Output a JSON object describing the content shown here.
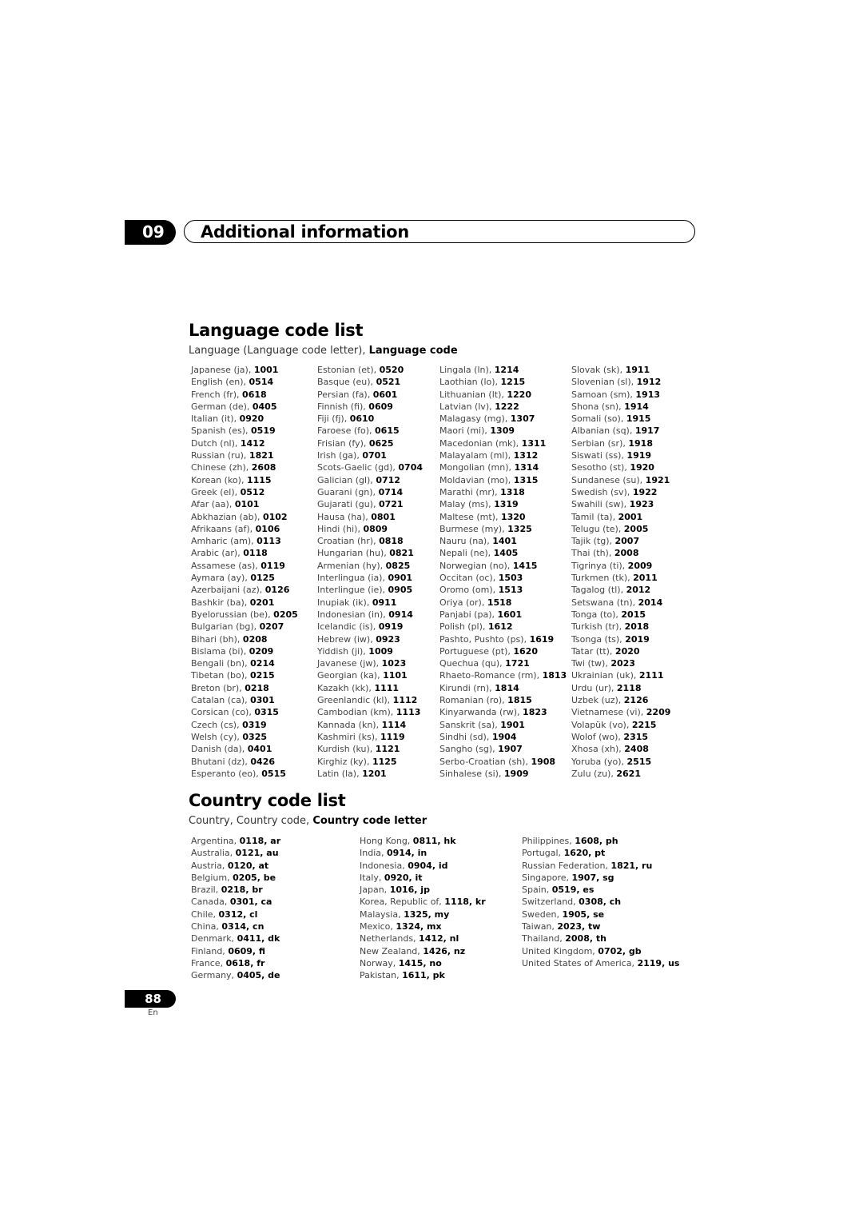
{
  "chapter": {
    "number": "09",
    "title": "Additional information"
  },
  "language_section": {
    "title": "Language code list",
    "subtitle_plain": "Language (Language code letter), ",
    "subtitle_bold": "Language code",
    "columns": [
      [
        [
          "Japanese (ja), ",
          "1001"
        ],
        [
          "English (en), ",
          "0514"
        ],
        [
          "French (fr), ",
          "0618"
        ],
        [
          "German (de), ",
          "0405"
        ],
        [
          "Italian (it), ",
          "0920"
        ],
        [
          "Spanish (es), ",
          "0519"
        ],
        [
          "Dutch (nl), ",
          "1412"
        ],
        [
          "Russian (ru), ",
          "1821"
        ],
        [
          "Chinese (zh), ",
          "2608"
        ],
        [
          "Korean (ko), ",
          "1115"
        ],
        [
          "Greek (el), ",
          "0512"
        ],
        [
          "Afar (aa), ",
          "0101"
        ],
        [
          "Abkhazian (ab), ",
          "0102"
        ],
        [
          "Afrikaans (af), ",
          "0106"
        ],
        [
          "Amharic (am), ",
          "0113"
        ],
        [
          "Arabic (ar), ",
          "0118"
        ],
        [
          "Assamese (as), ",
          "0119"
        ],
        [
          "Aymara (ay), ",
          "0125"
        ],
        [
          "Azerbaijani (az), ",
          "0126"
        ],
        [
          "Bashkir (ba), ",
          "0201"
        ],
        [
          "Byelorussian (be), ",
          "0205"
        ],
        [
          "Bulgarian (bg), ",
          "0207"
        ],
        [
          "Bihari (bh), ",
          "0208"
        ],
        [
          "Bislama (bi), ",
          "0209"
        ],
        [
          "Bengali (bn), ",
          "0214"
        ],
        [
          "Tibetan (bo), ",
          "0215"
        ],
        [
          "Breton (br), ",
          "0218"
        ],
        [
          "Catalan (ca), ",
          "0301"
        ],
        [
          "Corsican (co), ",
          "0315"
        ],
        [
          "Czech (cs), ",
          "0319"
        ],
        [
          "Welsh (cy), ",
          "0325"
        ],
        [
          "Danish (da), ",
          "0401"
        ],
        [
          "Bhutani (dz), ",
          "0426"
        ],
        [
          "Esperanto (eo), ",
          "0515"
        ]
      ],
      [
        [
          "Estonian (et), ",
          "0520"
        ],
        [
          "Basque (eu), ",
          "0521"
        ],
        [
          "Persian (fa), ",
          "0601"
        ],
        [
          "Finnish (fi), ",
          "0609"
        ],
        [
          "Fiji (fj), ",
          "0610"
        ],
        [
          "Faroese (fo), ",
          "0615"
        ],
        [
          "Frisian (fy), ",
          "0625"
        ],
        [
          "Irish (ga), ",
          "0701"
        ],
        [
          "Scots-Gaelic (gd), ",
          "0704"
        ],
        [
          "Galician (gl), ",
          "0712"
        ],
        [
          "Guarani (gn), ",
          "0714"
        ],
        [
          "Gujarati (gu), ",
          "0721"
        ],
        [
          "Hausa (ha), ",
          "0801"
        ],
        [
          "Hindi (hi), ",
          "0809"
        ],
        [
          "Croatian (hr), ",
          "0818"
        ],
        [
          "Hungarian (hu), ",
          "0821"
        ],
        [
          "Armenian (hy), ",
          "0825"
        ],
        [
          "Interlingua (ia), ",
          "0901"
        ],
        [
          "Interlingue (ie), ",
          "0905"
        ],
        [
          "Inupiak (ik), ",
          "0911"
        ],
        [
          "Indonesian (in), ",
          "0914"
        ],
        [
          "Icelandic (is), ",
          "0919"
        ],
        [
          "Hebrew (iw), ",
          "0923"
        ],
        [
          "Yiddish (ji), ",
          "1009"
        ],
        [
          "Javanese (jw), ",
          "1023"
        ],
        [
          "Georgian (ka), ",
          "1101"
        ],
        [
          "Kazakh (kk), ",
          "1111"
        ],
        [
          "Greenlandic  (kl), ",
          "1112"
        ],
        [
          "Cambodian (km), ",
          "1113"
        ],
        [
          "Kannada (kn), ",
          "1114"
        ],
        [
          "Kashmiri (ks), ",
          "1119"
        ],
        [
          "Kurdish (ku), ",
          "1121"
        ],
        [
          "Kirghiz (ky), ",
          "1125"
        ],
        [
          "Latin (la), ",
          "1201"
        ]
      ],
      [
        [
          "Lingala (ln), ",
          "1214"
        ],
        [
          "Laothian (lo), ",
          "1215"
        ],
        [
          "Lithuanian (lt), ",
          "1220"
        ],
        [
          "Latvian (lv), ",
          "1222"
        ],
        [
          "Malagasy (mg), ",
          "1307"
        ],
        [
          "Maori (mi), ",
          "1309"
        ],
        [
          "Macedonian (mk), ",
          "1311"
        ],
        [
          "Malayalam  (ml), ",
          "1312"
        ],
        [
          "Mongolian (mn), ",
          "1314"
        ],
        [
          "Moldavian (mo), ",
          "1315"
        ],
        [
          "Marathi (mr), ",
          "1318"
        ],
        [
          "Malay  (ms), ",
          "1319"
        ],
        [
          "Maltese (mt), ",
          "1320"
        ],
        [
          "Burmese (my), ",
          "1325"
        ],
        [
          "Nauru (na), ",
          "1401"
        ],
        [
          "Nepali (ne), ",
          "1405"
        ],
        [
          "Norwegian (no), ",
          "1415"
        ],
        [
          "Occitan (oc), ",
          "1503"
        ],
        [
          "Oromo (om), ",
          "1513"
        ],
        [
          "Oriya (or), ",
          "1518"
        ],
        [
          "Panjabi (pa), ",
          "1601"
        ],
        [
          "Polish (pl), ",
          "1612"
        ],
        [
          "Pashto, Pushto (ps), ",
          "1619"
        ],
        [
          "Portuguese (pt), ",
          "1620"
        ],
        [
          "Quechua (qu), ",
          "1721"
        ],
        [
          "Rhaeto-Romance (rm), ",
          "1813"
        ],
        [
          "Kirundi (rn), ",
          "1814"
        ],
        [
          "Romanian (ro), ",
          "1815"
        ],
        [
          "Kinyarwanda (rw), ",
          "1823"
        ],
        [
          "Sanskrit (sa), ",
          "1901"
        ],
        [
          "Sindhi (sd), ",
          "1904"
        ],
        [
          "Sangho (sg), ",
          "1907"
        ],
        [
          "Serbo-Croatian (sh), ",
          "1908"
        ],
        [
          "Sinhalese (si), ",
          "1909"
        ]
      ],
      [
        [
          "Slovak (sk), ",
          "1911"
        ],
        [
          "Slovenian (sl), ",
          "1912"
        ],
        [
          "Samoan (sm), ",
          "1913"
        ],
        [
          "Shona (sn), ",
          "1914"
        ],
        [
          "Somali (so), ",
          "1915"
        ],
        [
          "Albanian (sq), ",
          "1917"
        ],
        [
          "Serbian (sr), ",
          "1918"
        ],
        [
          "Siswati (ss), ",
          "1919"
        ],
        [
          "Sesotho (st), ",
          "1920"
        ],
        [
          "Sundanese (su), ",
          "1921"
        ],
        [
          "Swedish (sv), ",
          "1922"
        ],
        [
          "Swahili (sw), ",
          "1923"
        ],
        [
          "Tamil (ta), ",
          "2001"
        ],
        [
          "Telugu (te), ",
          "2005"
        ],
        [
          "Tajik (tg), ",
          "2007"
        ],
        [
          "Thai (th), ",
          "2008"
        ],
        [
          "Tigrinya (ti), ",
          "2009"
        ],
        [
          "Turkmen (tk), ",
          "2011"
        ],
        [
          "Tagalog (tl), ",
          "2012"
        ],
        [
          "Setswana (tn), ",
          "2014"
        ],
        [
          "Tonga (to), ",
          "2015"
        ],
        [
          "Turkish (tr), ",
          "2018"
        ],
        [
          "Tsonga (ts), ",
          "2019"
        ],
        [
          "Tatar (tt), ",
          "2020"
        ],
        [
          "Twi (tw), ",
          "2023"
        ],
        [
          "Ukrainian (uk), ",
          "2111"
        ],
        [
          "Urdu (ur), ",
          "2118"
        ],
        [
          "Uzbek (uz), ",
          "2126"
        ],
        [
          "Vietnamese (vi), ",
          "2209"
        ],
        [
          "Volapük (vo), ",
          "2215"
        ],
        [
          "Wolof (wo), ",
          "2315"
        ],
        [
          "Xhosa (xh), ",
          "2408"
        ],
        [
          "Yoruba (yo), ",
          "2515"
        ],
        [
          "Zulu (zu), ",
          "2621"
        ]
      ]
    ]
  },
  "country_section": {
    "title": "Country code list",
    "subtitle_plain": "Country, Country code, ",
    "subtitle_bold": "Country code letter",
    "columns": [
      [
        [
          "Argentina, ",
          "0118, ar"
        ],
        [
          "Australia, ",
          "0121, au"
        ],
        [
          "Austria, ",
          "0120, at"
        ],
        [
          "Belgium, ",
          "0205, be"
        ],
        [
          "Brazil, ",
          "0218, br"
        ],
        [
          "Canada, ",
          "0301, ca"
        ],
        [
          "Chile, ",
          "0312, cl"
        ],
        [
          "China, ",
          "0314, cn"
        ],
        [
          "Denmark, ",
          "0411, dk"
        ],
        [
          "Finland, ",
          "0609, fi"
        ],
        [
          "France, ",
          "0618, fr"
        ],
        [
          "Germany, ",
          "0405, de"
        ]
      ],
      [
        [
          "Hong Kong, ",
          "0811, hk"
        ],
        [
          "India, ",
          "0914, in"
        ],
        [
          "Indonesia, ",
          "0904, id"
        ],
        [
          "Italy, ",
          "0920, it"
        ],
        [
          "Japan, ",
          "1016, jp"
        ],
        [
          "Korea, Republic of, ",
          "1118, kr"
        ],
        [
          "Malaysia, ",
          "1325, my"
        ],
        [
          "Mexico, ",
          "1324, mx"
        ],
        [
          "Netherlands, ",
          "1412, nl"
        ],
        [
          "New Zealand, ",
          "1426, nz"
        ],
        [
          "Norway, ",
          "1415, no"
        ],
        [
          "Pakistan, ",
          "1611, pk"
        ]
      ],
      [
        [
          "Philippines, ",
          "1608, ph"
        ],
        [
          "Portugal, ",
          "1620, pt"
        ],
        [
          "Russian Federation, ",
          "1821, ru"
        ],
        [
          "Singapore, ",
          "1907, sg"
        ],
        [
          "Spain, ",
          "0519, es"
        ],
        [
          "Switzerland, ",
          "0308, ch"
        ],
        [
          "Sweden, ",
          "1905, se"
        ],
        [
          "Taiwan, ",
          "2023, tw"
        ],
        [
          "Thailand, ",
          "2008, th"
        ],
        [
          "United Kingdom, ",
          "0702, gb"
        ],
        [
          "United States of America, ",
          "2119, us"
        ]
      ]
    ]
  },
  "footer": {
    "page_number": "88",
    "language": "En"
  }
}
